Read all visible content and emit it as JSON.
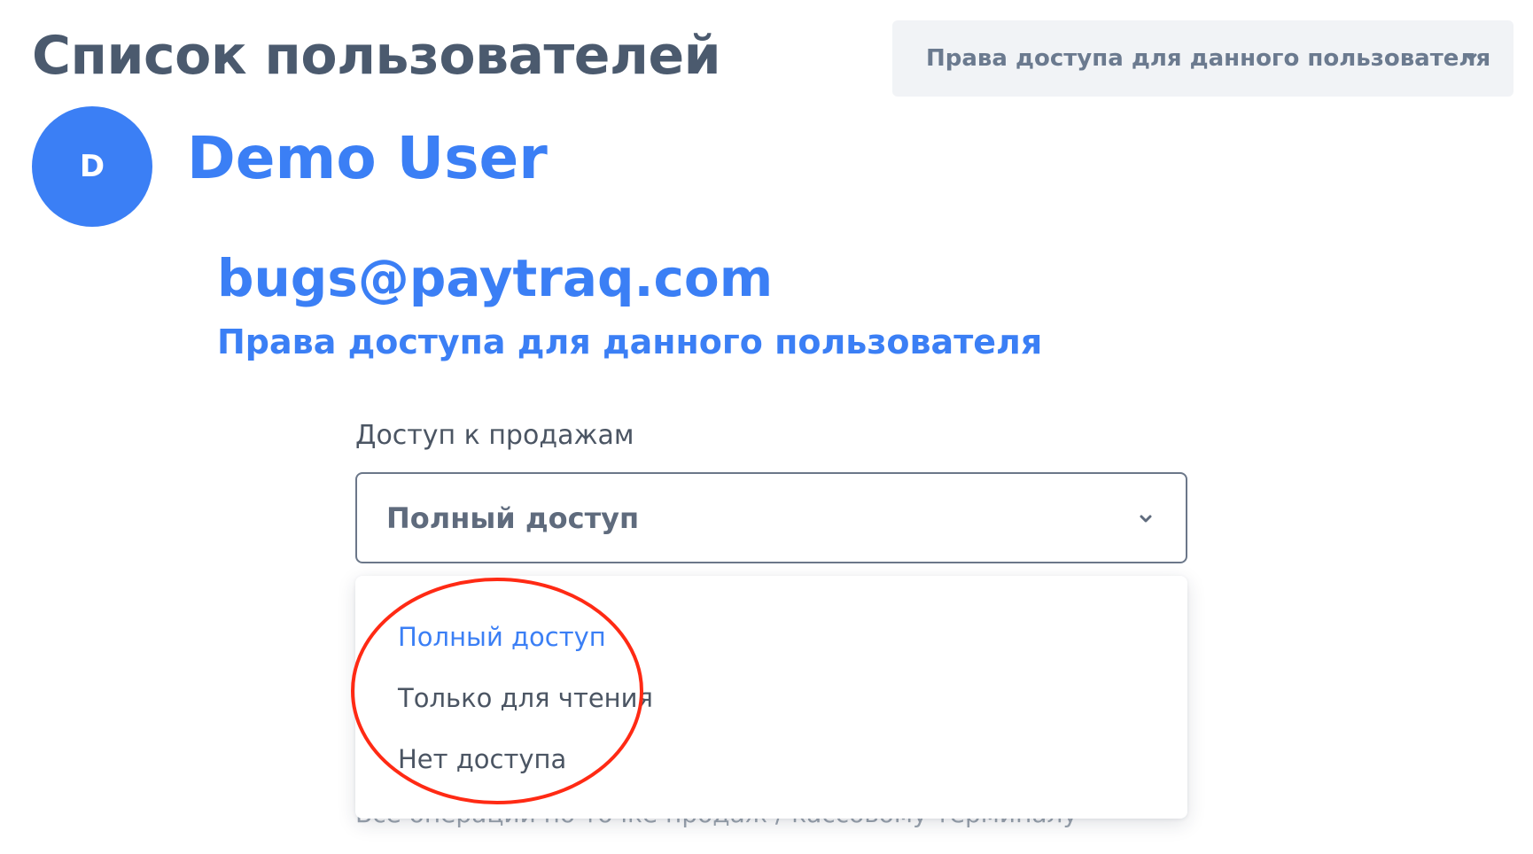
{
  "header": {
    "title": "Список пользователей",
    "permissions_dropdown_label": "Права доступа для данного пользователя"
  },
  "user": {
    "avatar_initial": "D",
    "name": "Demo User",
    "email": "bugs@paytraq.com"
  },
  "permissions": {
    "section_title": "Права доступа для данного пользователя",
    "sales_access": {
      "label": "Доступ к продажам",
      "selected_value": "Полный доступ",
      "options": [
        {
          "label": "Полный доступ",
          "selected": true
        },
        {
          "label": "Только для чтения",
          "selected": false
        },
        {
          "label": "Нет доступа",
          "selected": false
        }
      ],
      "hint": "Все операции по точке продаж / кассовому терминалу"
    }
  },
  "colors": {
    "accent": "#3b7ff5",
    "title_text": "#4b5a6e",
    "annotation_ring": "#ff2a14"
  },
  "icons": {
    "dropdown_chevron": "chevron-down-icon",
    "select_chevron": "chevron-down-icon"
  }
}
